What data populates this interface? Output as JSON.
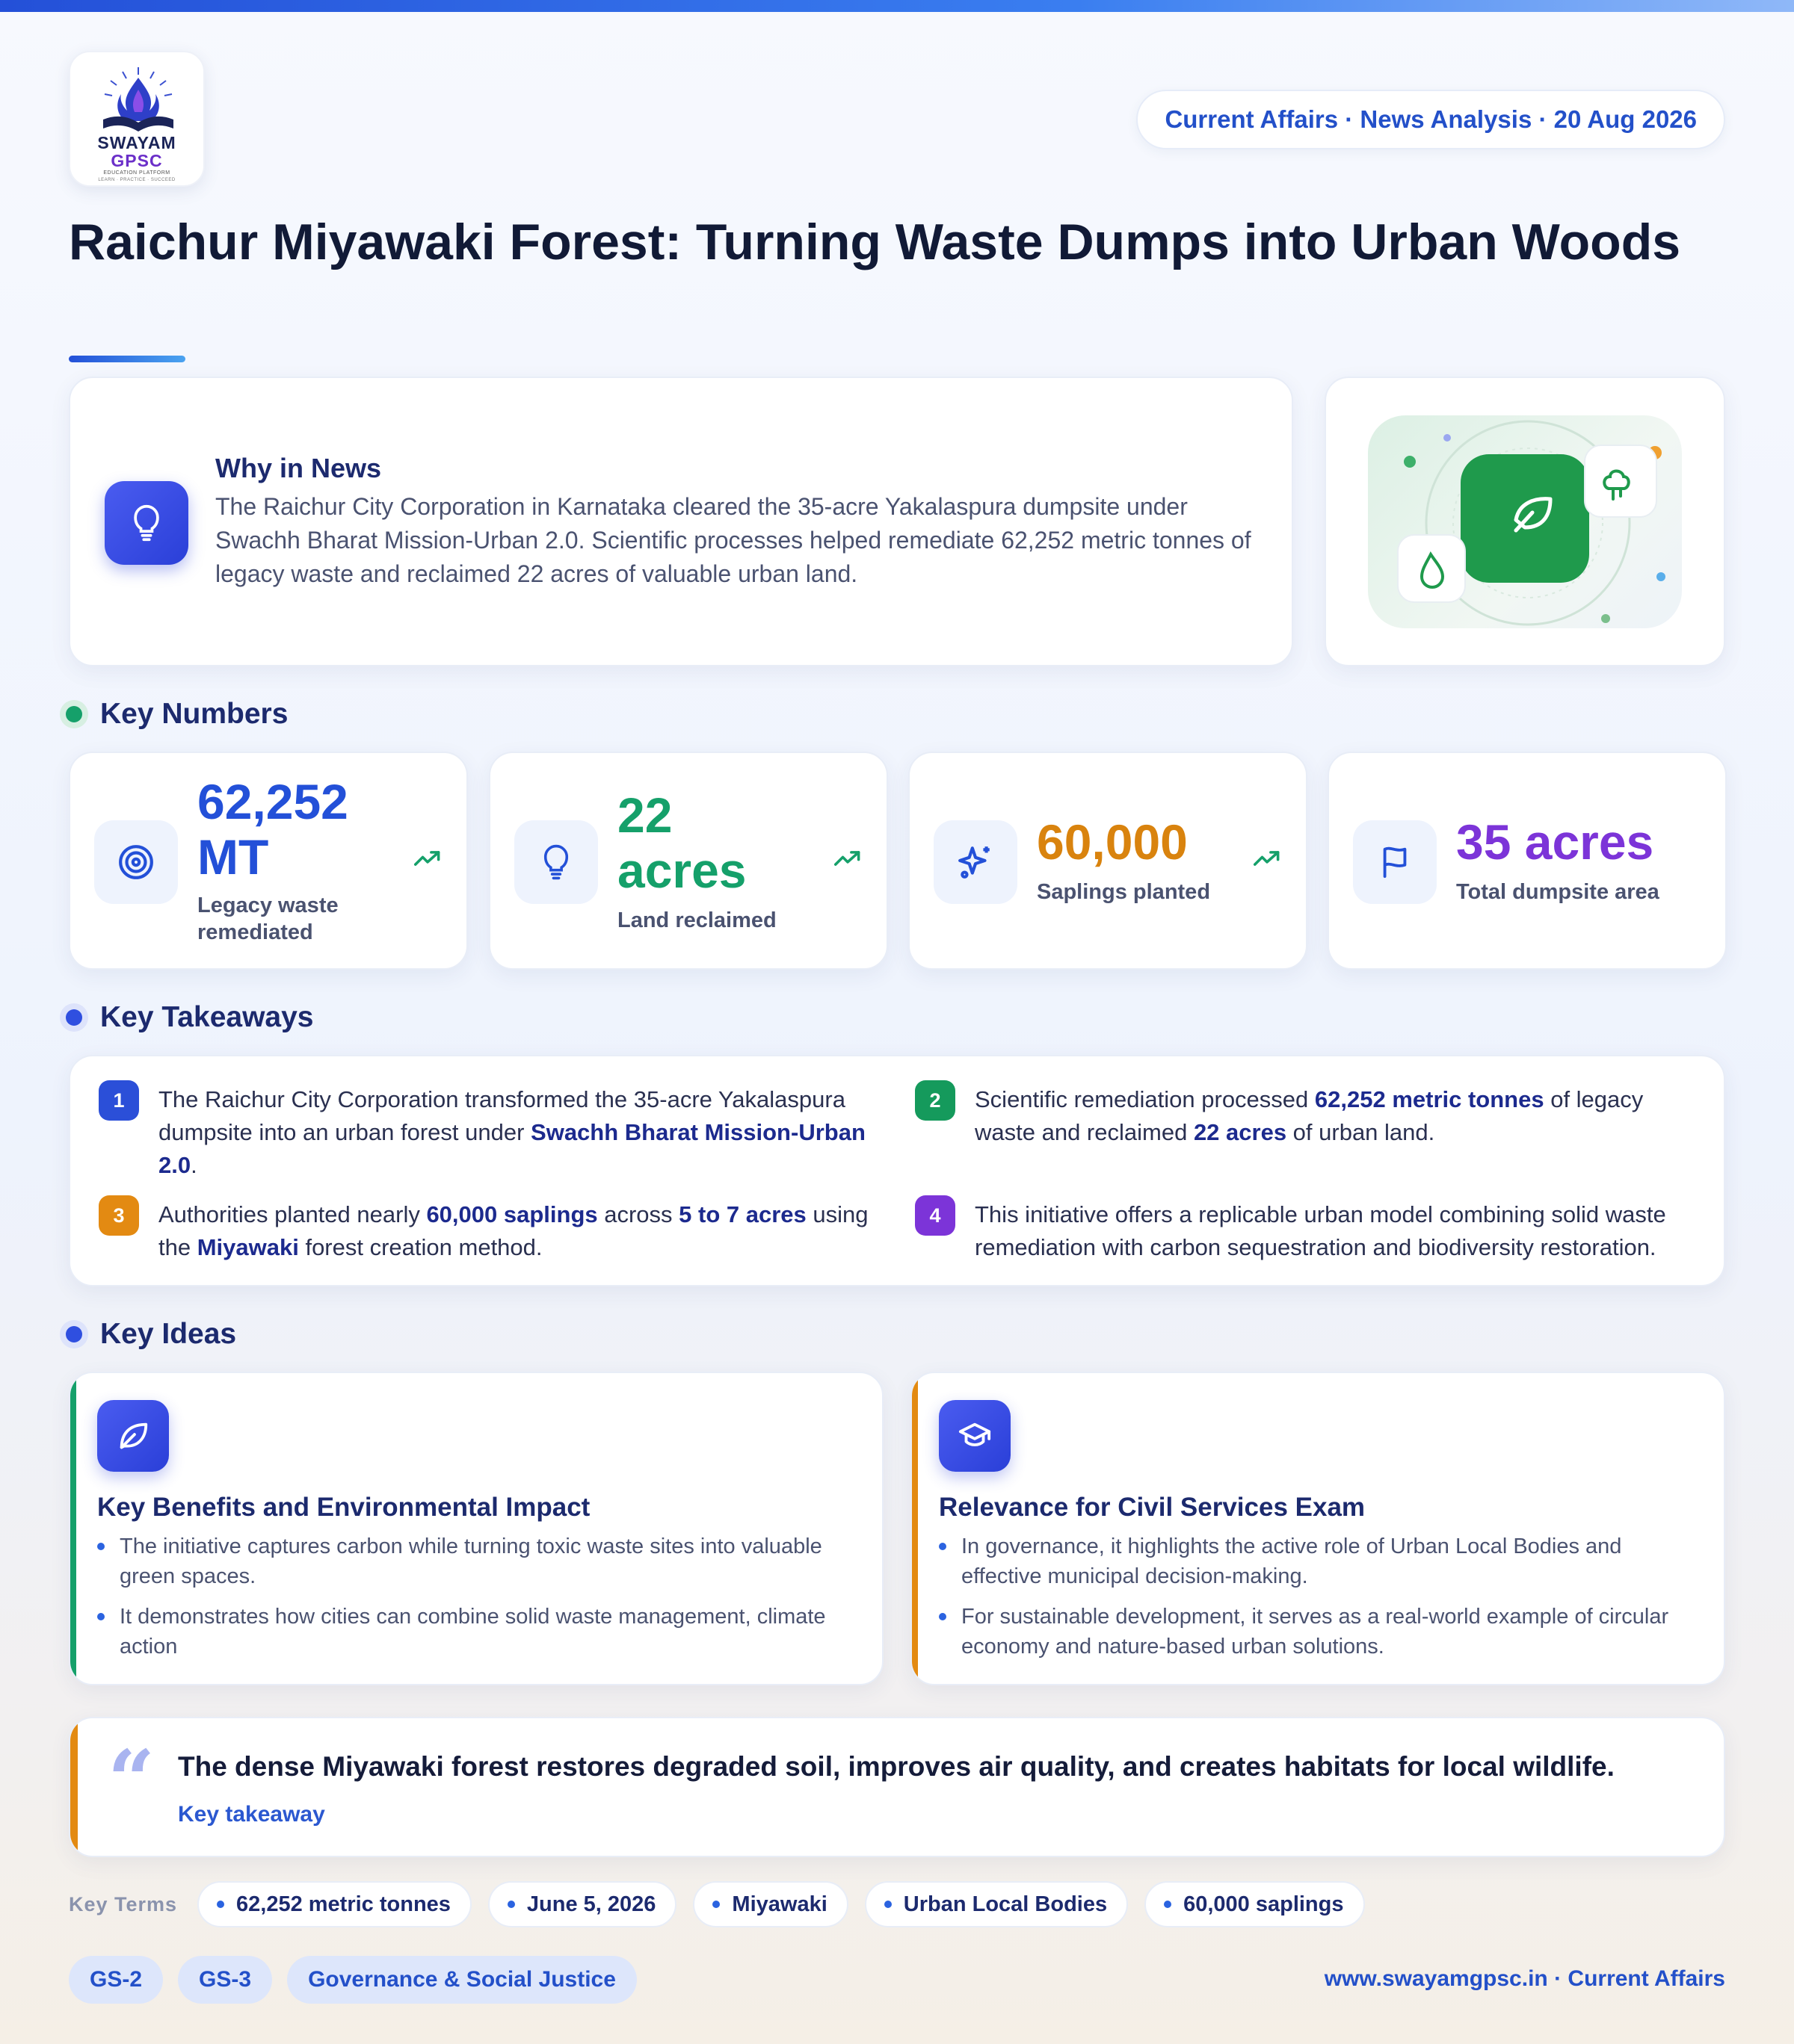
{
  "logo": {
    "line1": "SWAYAM",
    "line2": "GPSC",
    "line3": "EDUCATION PLATFORM",
    "line4": "LEARN · PRACTICE · SUCCEED"
  },
  "header": {
    "date_pill": "Current Affairs · News Analysis · 20 Aug 2026",
    "title": "Raichur Miyawaki Forest: Turning Waste Dumps into Urban Woods"
  },
  "why": {
    "heading": "Why in News",
    "text": "The Raichur City Corporation in Karnataka cleared the 35-acre Yakalaspura dumpsite under Swachh Bharat Mission-Urban 2.0. Scientific processes helped remediate 62,252 metric tonnes of legacy waste and reclaimed 22 acres of valuable urban land."
  },
  "sections": {
    "numbers": "Key Numbers",
    "takeaways": "Key Takeaways",
    "ideas": "Key Ideas"
  },
  "numbers": [
    {
      "value_line1": "62,252",
      "value_line2": "MT",
      "label_line1": "Legacy waste",
      "label_line2": "remediated",
      "color": "#2350d8"
    },
    {
      "value_line1": "22",
      "value_line2": "acres",
      "label": "Land reclaimed",
      "color": "#15a06a"
    },
    {
      "value": "60,000",
      "label": "Saplings planted",
      "color": "#d9830e"
    },
    {
      "value": "35 acres",
      "label": "Total dumpsite area",
      "color": "#7c34d8"
    }
  ],
  "takeaways": [
    {
      "num": "1",
      "color": "#2b4fd8",
      "t1": "The Raichur City Corporation transformed the 35-acre Yakalaspura dumpsite into an urban forest under ",
      "b1": "Swachh Bharat Mission-Urban 2.0",
      "t2": "."
    },
    {
      "num": "2",
      "color": "#159a5c",
      "t1": "Scientific remediation processed ",
      "b1": "62,252 metric tonnes",
      "t2": " of legacy waste and reclaimed ",
      "b2": "22 acres",
      "t3": " of urban land."
    },
    {
      "num": "3",
      "color": "#e38a12",
      "t1": "Authorities planted nearly ",
      "b1": "60,000 saplings",
      "t2": " across ",
      "b2": "5 to 7 acres",
      "t3": " using the ",
      "b3": "Miyawaki",
      "t4": " forest creation method."
    },
    {
      "num": "4",
      "color": "#7c34d8",
      "t1": "This initiative offers a replicable urban model combining solid waste remediation with carbon sequestration and biodiversity restoration."
    }
  ],
  "ideas": [
    {
      "title": "Key Benefits and Environmental Impact",
      "stripe": "#15a06a",
      "points": [
        "The initiative captures carbon while turning toxic waste sites into valuable green spaces.",
        "It demonstrates how cities can combine solid waste management, climate action"
      ]
    },
    {
      "title": "Relevance for Civil Services Exam",
      "stripe": "#e38a12",
      "points": [
        "In governance, it highlights the active role of Urban Local Bodies and effective municipal decision-making.",
        "For sustainable development, it serves as a real-world example of circular economy and nature-based urban solutions."
      ]
    }
  ],
  "quote": {
    "text": "The dense Miyawaki forest restores degraded soil, improves air quality, and creates habitats for local wildlife.",
    "source": "Key takeaway"
  },
  "terms": {
    "label": "Key Terms",
    "items": [
      "62,252 metric tonnes",
      "June 5, 2026",
      "Miyawaki",
      "Urban Local Bodies",
      "60,000 saplings"
    ]
  },
  "tags": [
    "GS-2",
    "GS-3",
    "Governance & Social Justice"
  ],
  "footer": "www.swayamgpsc.in · Current Affairs",
  "colors": {
    "accent": "#2350d8",
    "green": "#15a06a",
    "orange": "#e38a12",
    "purple": "#7c34d8"
  }
}
